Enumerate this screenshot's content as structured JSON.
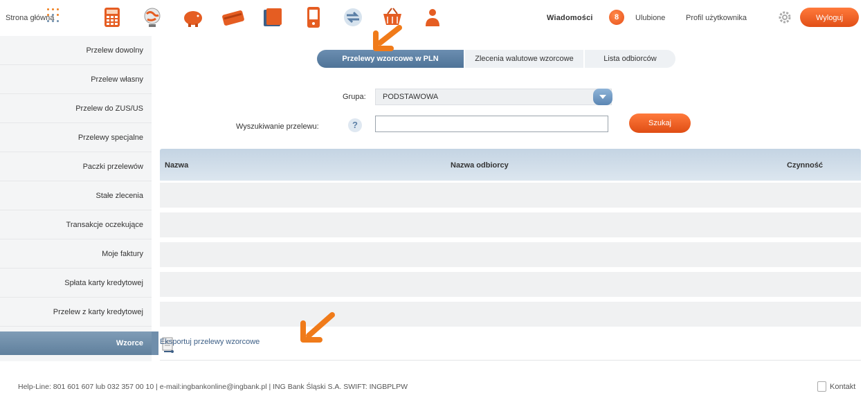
{
  "topbar": {
    "home_label": "Strona główna",
    "icons": [
      "calculator-icon",
      "globe-icon",
      "piggy-bank-icon",
      "card-icon",
      "wallet-icon",
      "phone-icon",
      "transfer-icon",
      "basket-icon",
      "insurance-icon"
    ],
    "messages_label": "Wiadomości",
    "messages_count": "8",
    "favourites_label": "Ulubione",
    "profile_label": "Profil użytkownika",
    "logout_label": "Wyloguj"
  },
  "sidebar": {
    "items": [
      {
        "label": "Przelew dowolny"
      },
      {
        "label": "Przelew własny"
      },
      {
        "label": "Przelew do ZUS/US"
      },
      {
        "label": "Przelewy specjalne"
      },
      {
        "label": "Paczki przelewów"
      },
      {
        "label": "Stałe zlecenia"
      },
      {
        "label": "Transakcje oczekujące"
      },
      {
        "label": "Moje faktury"
      },
      {
        "label": "Spłata karty kredytowej"
      },
      {
        "label": "Przelew z karty kredytowej"
      },
      {
        "label": "Wzorce"
      }
    ],
    "active_index": 10
  },
  "tabs": [
    {
      "label": "Przelewy wzorcowe w PLN",
      "active": true
    },
    {
      "label": "Zlecenia walutowe wzorcowe",
      "active": false
    },
    {
      "label": "Lista odbiorców",
      "active": false
    }
  ],
  "form": {
    "group_label": "Grupa:",
    "group_value": "PODSTAWOWA",
    "search_label": "Wyszukiwanie przelewu:",
    "search_value": "",
    "search_button": "Szukaj"
  },
  "table": {
    "columns": [
      "Nazwa",
      "Nazwa odbiorcy",
      "Czynność"
    ],
    "rows": [
      [],
      [],
      [],
      [],
      [],
      []
    ]
  },
  "export_label": "Eksportuj przelewy wzorcowe",
  "footer": {
    "text": "Help-Line: 801 601 607 lub 032 357 00 10 | e-mail:ingbankonline@ingbank.pl | ING Bank Śląski S.A. SWIFT: INGBPLPW",
    "contact_label": "Kontakt"
  },
  "colors": {
    "accent_orange": "#f06a28",
    "nav_blue": "#5b7fa6",
    "header_blue": "#c4d4e3"
  }
}
